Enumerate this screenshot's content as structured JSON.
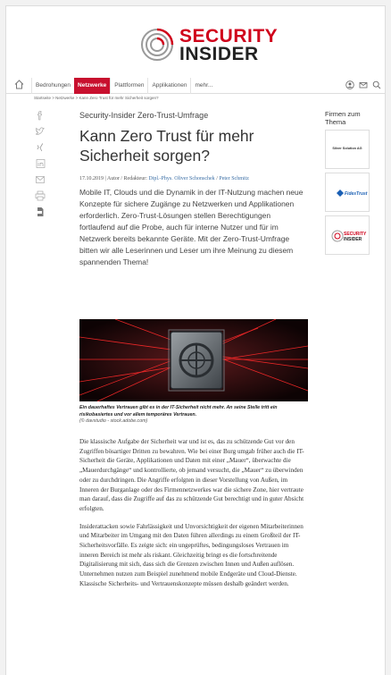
{
  "brand": {
    "line1": "SECURITY",
    "line2": "INSIDER"
  },
  "nav": {
    "items": [
      "Bedrohungen",
      "Netzwerke",
      "Plattformen",
      "Applikationen",
      "mehr..."
    ],
    "active": "Netzwerke"
  },
  "breadcrumb": "Startseite > Netzwerke > Kann Zero Trust für mehr Sicherheit sorgen?",
  "article": {
    "kicker": "Security-Insider Zero-Trust-Umfrage",
    "title": "Kann Zero Trust für mehr Sicherheit sorgen?",
    "meta": {
      "date": "17.10.2019 | Autor / Redakteur: ",
      "author1": "Dipl.-Phys. Oliver Schonschek",
      "sep": " / ",
      "author2": "Peter Schmitz"
    },
    "lead": "Mobile IT, Clouds und die Dynamik in der IT-Nutzung machen neue Konzepte für sichere Zugänge zu Netzwerken und Applikationen erforderlich. Zero-Trust-Lösungen stellen Berechtigungen fortlaufend auf die Probe, auch für interne Nutzer und für im Netzwerk bereits bekannte Geräte. Mit der Zero-Trust-Umfrage bitten wir alle Leserinnen und Leser um ihre Meinung zu diesem spannenden Thema!",
    "caption": "Ein dauerhaftes Vertrauen gibt es in der IT-Sicherheit nicht mehr. An seine Stelle tritt ein risikobasiertes und vor allem temporäres Vertrauen.",
    "credit": "(© davstudio - stock.adobe.com)",
    "paragraphs": [
      "Die klassische Aufgabe der Sicherheit war und ist es, das zu schützende Gut vor den Zugriffen bösartiger Dritten zu bewahren. Wie bei einer Burg umgab früher auch die IT-Sicherheit die Geräte, Applikationen und Daten mit einer „Mauer“, überwachte die „Mauerdurchgänge“ und kontrollierte, ob jemand versucht, die „Mauer“ zu überwinden oder zu durchdringen. Die Angriffe erfolgten in dieser Vorstellung von Außen, im Inneren der Burganlage oder des Firmennetzwerkes war die sichere Zone, hier vertraute man darauf, dass die Zugriffe auf das zu schützende Gut berechtigt und in guter Absicht erfolgten.",
      "Insiderattacken sowie Fahrlässigkeit und Unvorsichtigkeit der eigenen Mitarbeiterinnen und Mitarbeiter im Umgang mit den Daten führen allerdings zu einem Großteil der IT-Sicherheitsvorfälle. Es zeigte sich: ein ungeprüftes, bedingungsloses Vertrauen im inneren Bereich ist mehr als riskant. Gleichzeitig bringt es die fortschreitende Digitalisierung mit sich, dass sich die Grenzen zwischen Innen und Außen auflösen. Unternehmen nutzen zum Beispiel zunehmend mobile Endgeräte und Cloud-Dienste. Klassische Sicherheits- und Vertrauenskonzepte müssen deshalb geändert werden."
    ]
  },
  "sidebar": {
    "heading": "Firmen zum Thema",
    "cards": [
      "Silver Solution AG",
      "FidesTrust",
      "SECURITY INSIDER"
    ]
  },
  "colors": {
    "brand_red": "#c8102e",
    "link": "#3a6ea5"
  },
  "icons": {
    "share": [
      "facebook-icon",
      "twitter-icon",
      "xing-icon",
      "linkedin-icon",
      "email-icon",
      "print-icon",
      "pdf-icon"
    ],
    "header": [
      "user-icon",
      "mail-icon",
      "search-icon"
    ]
  }
}
